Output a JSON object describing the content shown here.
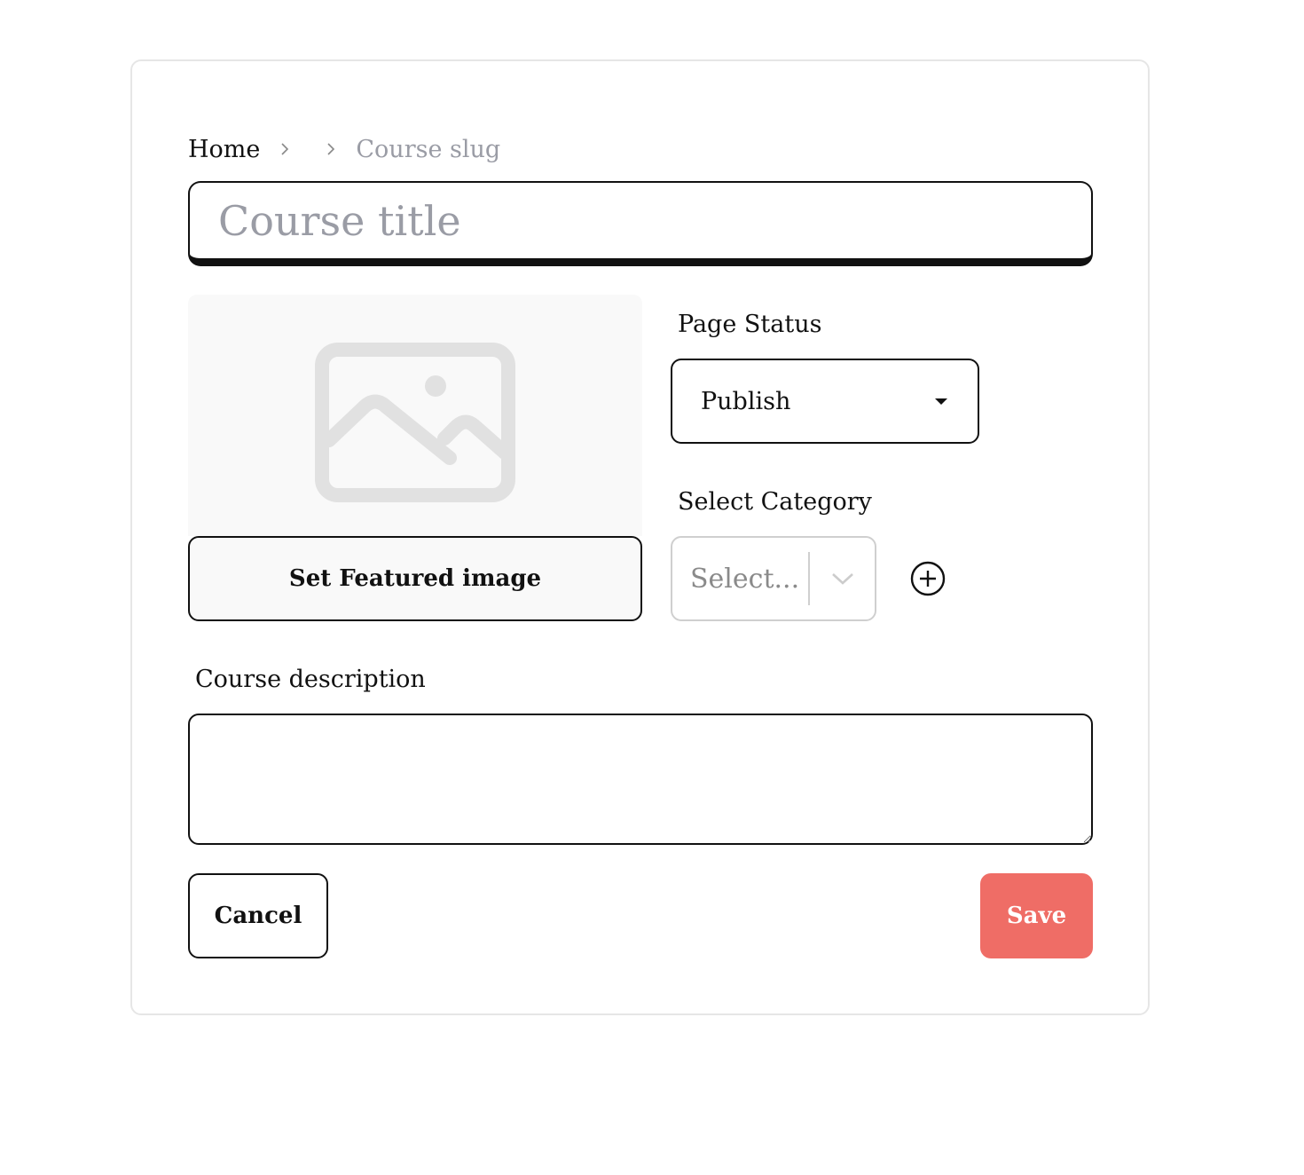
{
  "breadcrumb": {
    "home": "Home",
    "middle": "",
    "current": "Course slug"
  },
  "title_field": {
    "value": "",
    "placeholder": "Course title"
  },
  "featured_image": {
    "button_label": "Set Featured image",
    "icon": "image-placeholder-icon"
  },
  "page_status": {
    "label": "Page Status",
    "selected": "Publish"
  },
  "category": {
    "label": "Select Category",
    "placeholder": "Select..."
  },
  "description": {
    "label": "Course description",
    "value": ""
  },
  "actions": {
    "cancel_label": "Cancel",
    "save_label": "Save"
  },
  "colors": {
    "accent": "#ef6d66",
    "placeholder_text": "#9a9ca5",
    "border": "#111111"
  }
}
